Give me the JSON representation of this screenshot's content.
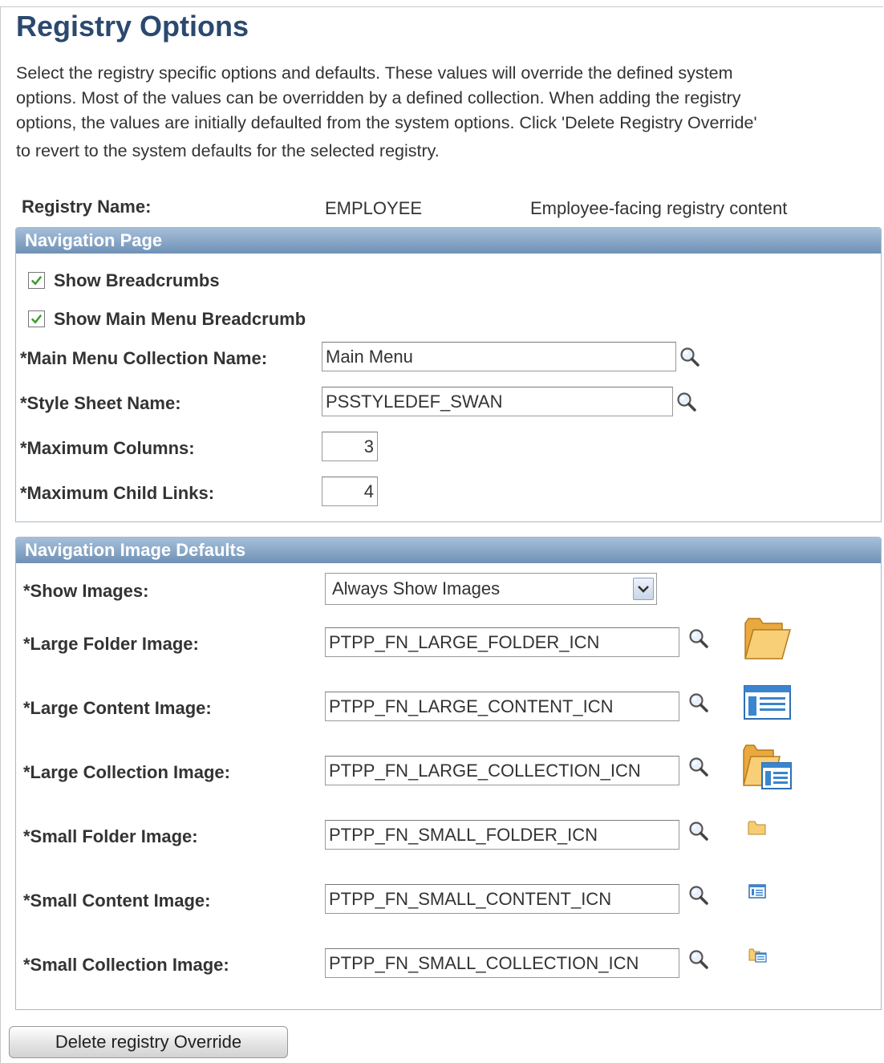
{
  "page": {
    "title": "Registry Options",
    "description_lines": [
      "Select the registry specific options and defaults. These values will override the defined system",
      "options. Most of the values can be overridden by a defined collection. When adding the registry",
      "options, the values are initially defaulted from the system options. Click 'Delete Registry Override'",
      "to revert to the system defaults for the selected registry."
    ]
  },
  "registry": {
    "label": "Registry Name:",
    "name": "EMPLOYEE",
    "description": "Employee-facing registry content"
  },
  "navigation_page": {
    "header": "Navigation Page",
    "show_breadcrumbs": {
      "label": "Show Breadcrumbs",
      "checked": true
    },
    "show_main_menu_breadcrumb": {
      "label": "Show Main Menu Breadcrumb",
      "checked": true
    },
    "main_menu_collection": {
      "label": "*Main Menu Collection Name:",
      "value": "Main Menu"
    },
    "style_sheet": {
      "label": "*Style Sheet Name:",
      "value": "PSSTYLEDEF_SWAN"
    },
    "max_columns": {
      "label": "*Maximum Columns:",
      "value": "3"
    },
    "max_child_links": {
      "label": "*Maximum Child Links:",
      "value": "4"
    }
  },
  "image_defaults": {
    "header": "Navigation Image Defaults",
    "show_images": {
      "label": "*Show Images:",
      "value": "Always Show Images"
    },
    "large_folder": {
      "label": "*Large Folder Image:",
      "value": "PTPP_FN_LARGE_FOLDER_ICN",
      "icon": "large-folder-icon"
    },
    "large_content": {
      "label": "*Large Content Image:",
      "value": "PTPP_FN_LARGE_CONTENT_ICN",
      "icon": "large-content-icon"
    },
    "large_collection": {
      "label": "*Large Collection Image:",
      "value": "PTPP_FN_LARGE_COLLECTION_ICN",
      "icon": "large-collection-icon"
    },
    "small_folder": {
      "label": "*Small Folder Image:",
      "value": "PTPP_FN_SMALL_FOLDER_ICN",
      "icon": "small-folder-icon"
    },
    "small_content": {
      "label": "*Small Content Image:",
      "value": "PTPP_FN_SMALL_CONTENT_ICN",
      "icon": "small-content-icon"
    },
    "small_collection": {
      "label": "*Small Collection Image:",
      "value": "PTPP_FN_SMALL_COLLECTION_ICN",
      "icon": "small-collection-icon"
    }
  },
  "actions": {
    "delete_override": "Delete registry Override"
  },
  "colors": {
    "title": "#2b4970",
    "header_top": "#a6bfd9",
    "header_bottom": "#6f91b6",
    "folder": "#f5c66b",
    "check": "#3a9a2a"
  }
}
